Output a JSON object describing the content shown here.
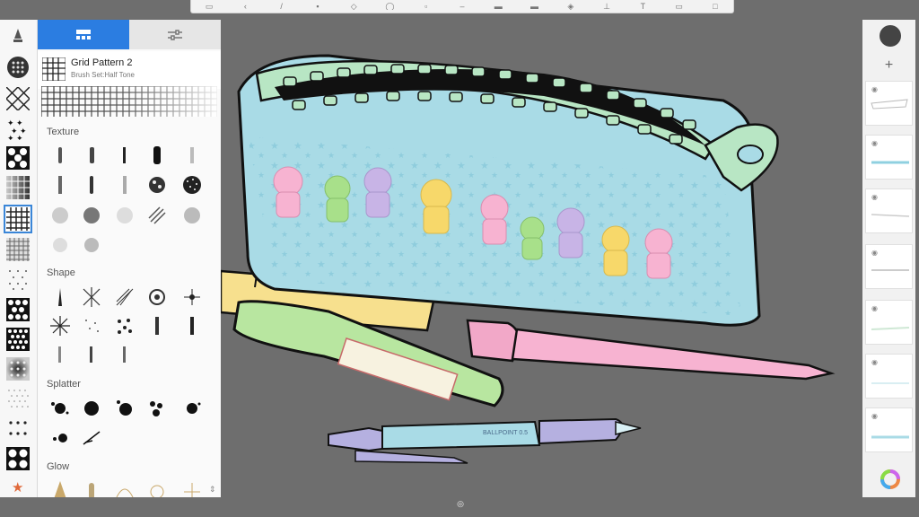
{
  "library": {
    "current_brush": {
      "name": "Grid Pattern 2",
      "set": "Brush Set:Half Tone"
    },
    "sections": {
      "texture": "Texture",
      "shape": "Shape",
      "splatter": "Splatter",
      "glow": "Glow"
    }
  },
  "toolbar": {
    "icons": [
      "undo-icon",
      "redo-icon",
      "brush-icon",
      "eraser-icon",
      "selection-icon",
      "transform-icon",
      "crop-icon",
      "ruler-icon",
      "fill-icon",
      "color-icon",
      "layers-icon",
      "perspective-icon",
      "text-icon",
      "image-icon",
      "fullscreen-icon"
    ]
  },
  "layers": {
    "add_label": "+"
  },
  "canvas": {
    "ballpoint_text": "BALLPOINT 0.5"
  },
  "colors": {
    "accent": "#2b7de1",
    "canvas_bg": "#6e6e6e",
    "case_blue": "#a9dbe6",
    "zipper_green": "#b8e6c4",
    "ruler": "#f7e08e",
    "pencil_pink": "#f7b3d1"
  }
}
